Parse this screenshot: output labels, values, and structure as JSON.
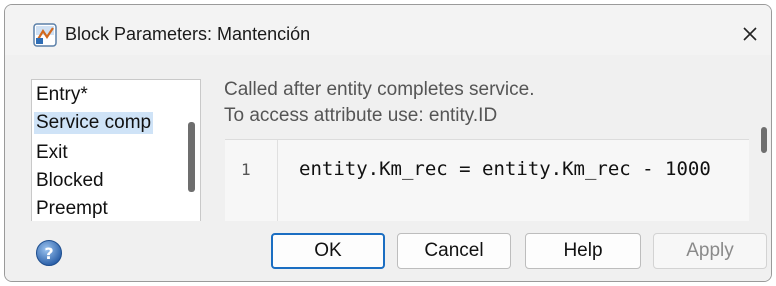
{
  "window": {
    "title": "Block Parameters: Mantención",
    "close_glyph": "✕"
  },
  "event_list": {
    "items": [
      "Entry*",
      "Service comp",
      "Exit",
      "Blocked",
      "Preempt"
    ],
    "selected_index": 1
  },
  "editor": {
    "description_line1": "Called after entity completes service.",
    "description_line2": "To access attribute use: entity.ID",
    "line_number": "1",
    "code": "entity.Km_rec = entity.Km_rec - 1000"
  },
  "buttons": {
    "ok": "OK",
    "cancel": "Cancel",
    "help": "Help",
    "apply": "Apply"
  },
  "colors": {
    "primary_border": "#1b6ec2",
    "selection": "#cfe3f7"
  },
  "icons": {
    "title": "simulink-block-icon",
    "help": "help-question-icon"
  }
}
